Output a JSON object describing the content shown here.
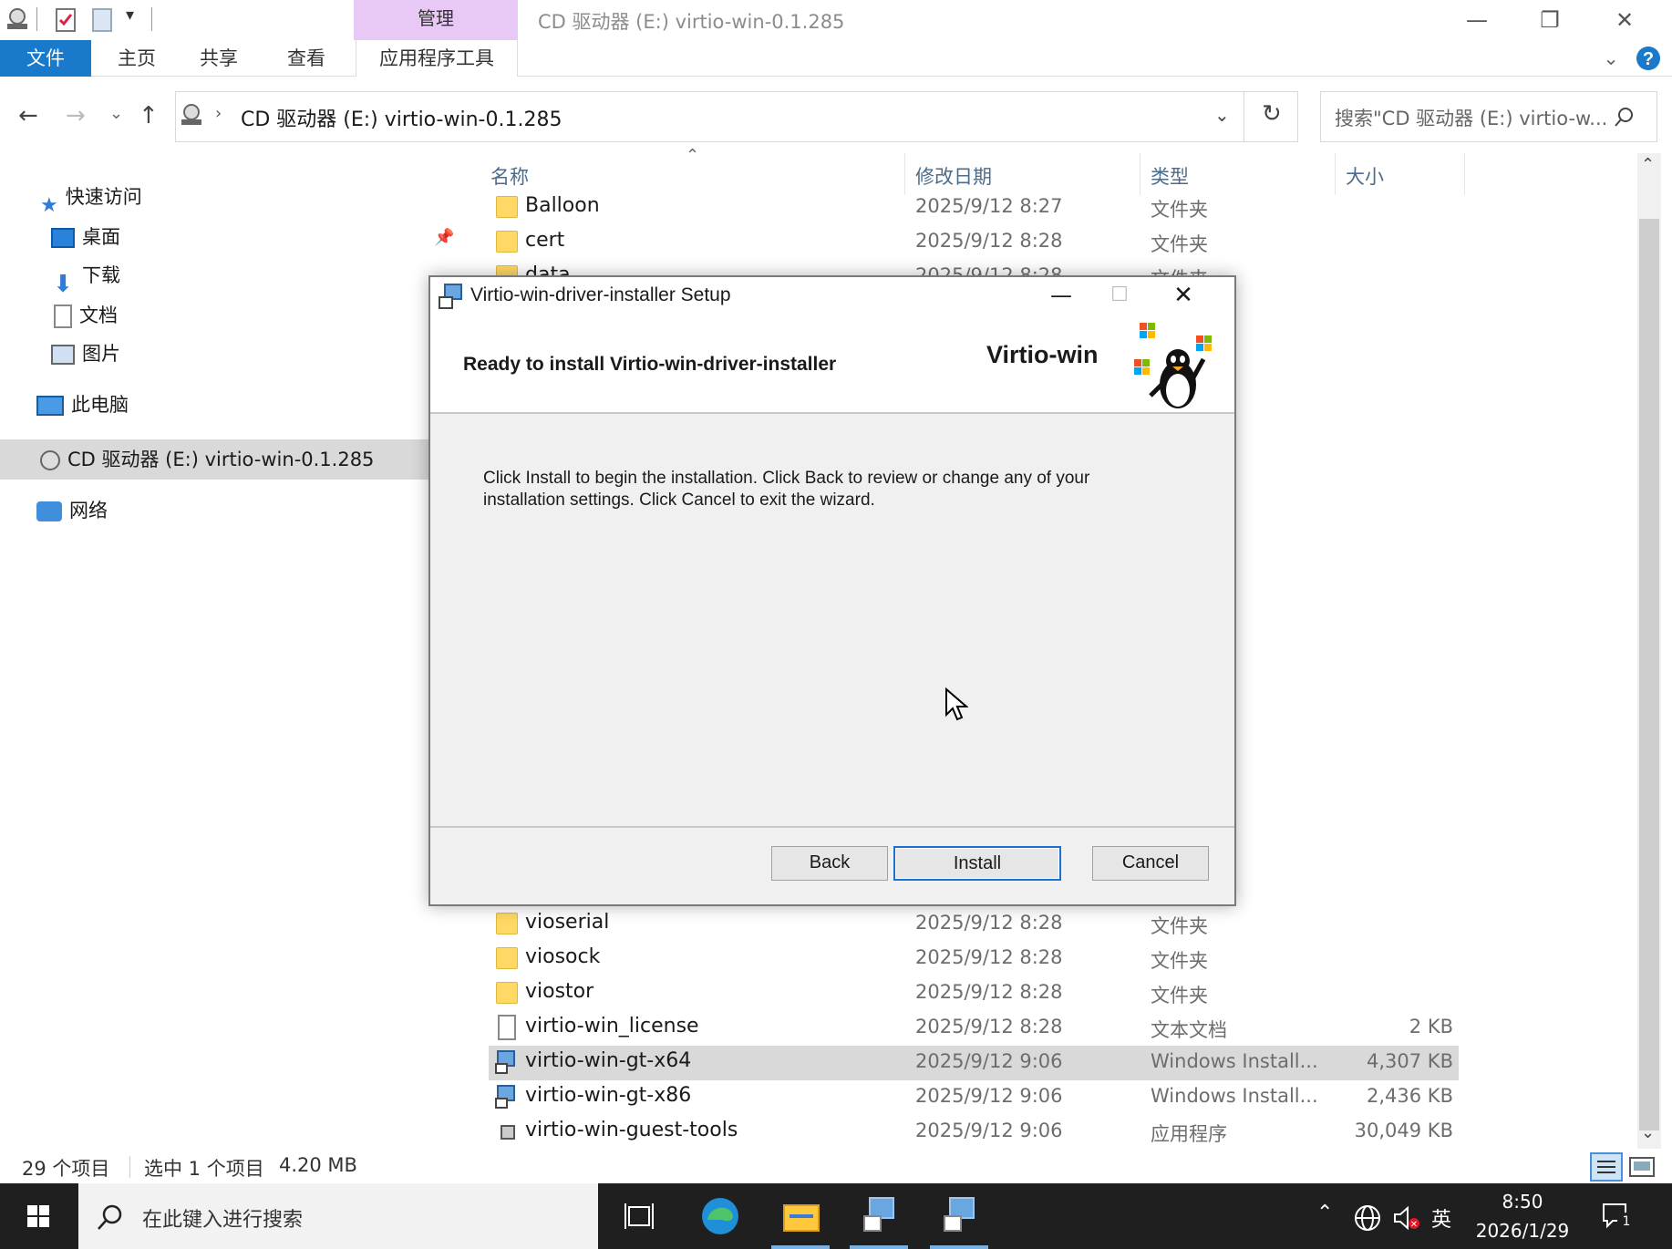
{
  "window": {
    "title": "CD 驱动器 (E:) virtio-win-0.1.285",
    "context_tab": "管理"
  },
  "ribbon": {
    "tabs": [
      "文件",
      "主页",
      "共享",
      "查看",
      "应用程序工具"
    ]
  },
  "address": {
    "path": "CD 驱动器 (E:) virtio-win-0.1.285",
    "search_placeholder": "搜索\"CD 驱动器 (E:) virtio-w..."
  },
  "nav": {
    "quick_access": "快速访问",
    "desktop": "桌面",
    "downloads": "下载",
    "documents": "文档",
    "pictures": "图片",
    "this_pc": "此电脑",
    "cd_drive": "CD 驱动器 (E:) virtio-win-0.1.285",
    "network": "网络"
  },
  "columns": {
    "name": "名称",
    "date": "修改日期",
    "type": "类型",
    "size": "大小"
  },
  "files_top": [
    {
      "name": "Balloon",
      "date": "2025/9/12 8:27",
      "type": "文件夹",
      "size": ""
    },
    {
      "name": "cert",
      "date": "2025/9/12 8:28",
      "type": "文件夹",
      "size": ""
    },
    {
      "name": "data",
      "date": "2025/9/12 8:28",
      "type": "文件夹",
      "size": ""
    }
  ],
  "files_bottom": [
    {
      "name": "vioserial",
      "date": "2025/9/12 8:28",
      "type": "文件夹",
      "size": "",
      "kind": "folder"
    },
    {
      "name": "viosock",
      "date": "2025/9/12 8:28",
      "type": "文件夹",
      "size": "",
      "kind": "folder"
    },
    {
      "name": "viostor",
      "date": "2025/9/12 8:28",
      "type": "文件夹",
      "size": "",
      "kind": "folder"
    },
    {
      "name": "virtio-win_license",
      "date": "2025/9/12 8:28",
      "type": "文本文档",
      "size": "2 KB",
      "kind": "doc"
    },
    {
      "name": "virtio-win-gt-x64",
      "date": "2025/9/12 9:06",
      "type": "Windows Install...",
      "size": "4,307 KB",
      "kind": "msi",
      "selected": true
    },
    {
      "name": "virtio-win-gt-x86",
      "date": "2025/9/12 9:06",
      "type": "Windows Install...",
      "size": "2,436 KB",
      "kind": "msi"
    },
    {
      "name": "virtio-win-guest-tools",
      "date": "2025/9/12 9:06",
      "type": "应用程序",
      "size": "30,049 KB",
      "kind": "exe"
    }
  ],
  "status": {
    "count": "29 个项目",
    "selection": "选中 1 个项目",
    "size": "4.20 MB"
  },
  "dialog": {
    "title": "Virtio-win-driver-installer Setup",
    "heading": "Ready to install Virtio-win-driver-installer",
    "brand": "Virtio-win",
    "body_line1": "Click Install to begin the installation. Click Back to review or change any of your",
    "body_line2": "installation settings. Click Cancel to exit the wizard.",
    "back_label": "Back",
    "install_label": "Install",
    "cancel_label": "Cancel"
  },
  "taskbar": {
    "search_placeholder": "在此键入进行搜索",
    "ime": "英",
    "time": "8:50",
    "date": "2026/1/29",
    "notification_count": "1"
  },
  "colors": {
    "file_tab": "#1979ca",
    "context_tab": "#e8c8f4",
    "selection": "#d9d9d9",
    "taskbar": "#1f1f1f"
  }
}
